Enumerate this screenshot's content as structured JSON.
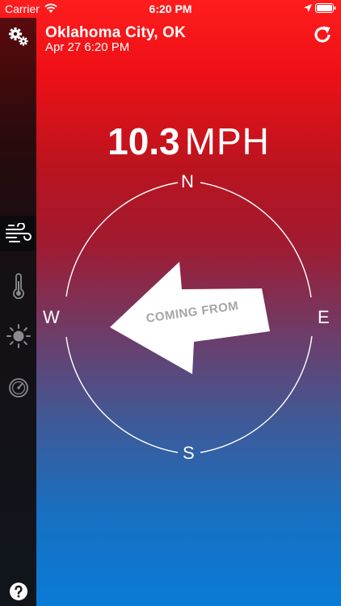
{
  "status_bar": {
    "carrier": "Carrier",
    "time": "6:20 PM"
  },
  "header": {
    "location": "Oklahoma City, OK",
    "datetime": "Apr 27 6:20 PM"
  },
  "wind": {
    "speed": "10.3",
    "unit": "MPH",
    "arrow_label": "COMING FROM",
    "compass": {
      "north": "N",
      "south": "S",
      "west": "W",
      "east": "E"
    }
  },
  "sidebar": {
    "items": [
      {
        "icon": "gear-icon"
      },
      {
        "icon": "wind-icon",
        "active": true
      },
      {
        "icon": "thermometer-icon"
      },
      {
        "icon": "sun-icon"
      },
      {
        "icon": "gauge-icon"
      },
      {
        "icon": "help-icon"
      }
    ]
  },
  "colors": {
    "gradient_top": "#ff1d1d",
    "gradient_bottom": "#0a7bd6",
    "sidebar_active": "#0b0b0d"
  }
}
